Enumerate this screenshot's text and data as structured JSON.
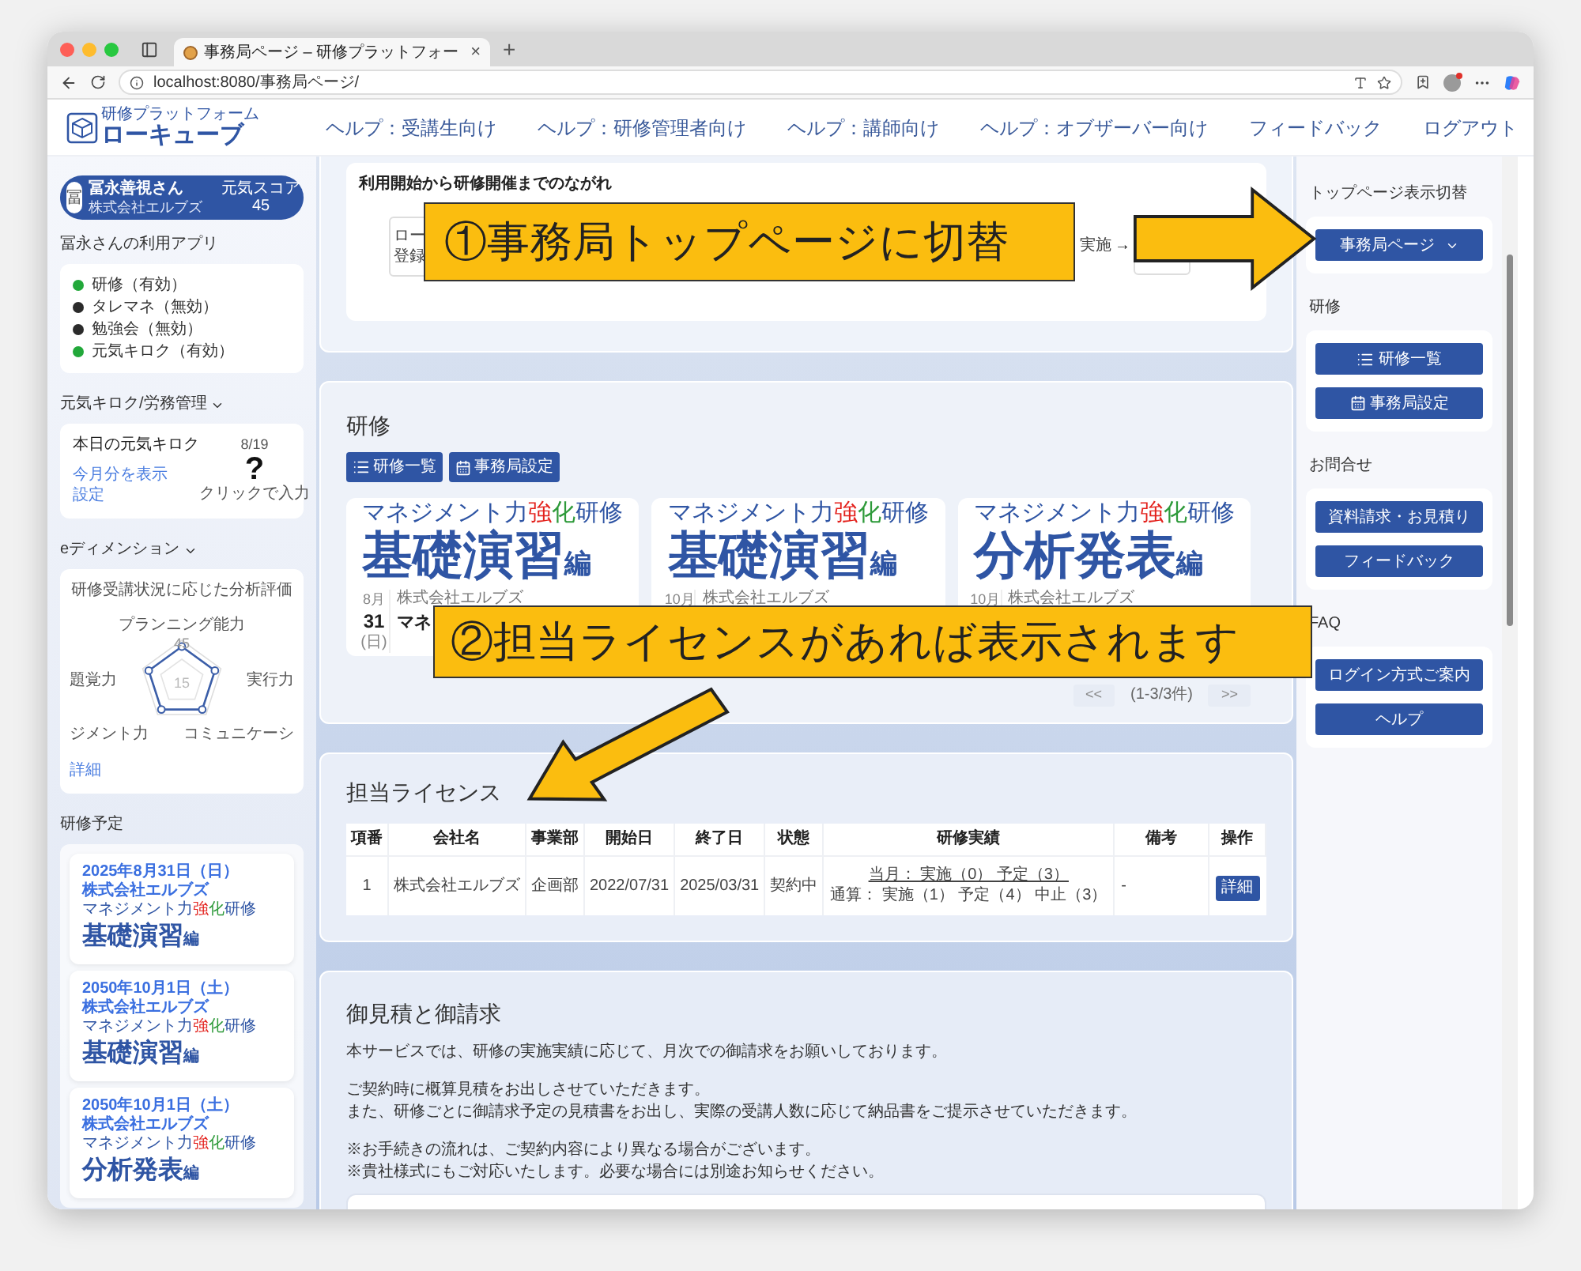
{
  "browser": {
    "tab_title": "事務局ページ – 研修プラットフォー",
    "tab_close": "×",
    "new_tab": "+",
    "url": "localhost:8080/事務局ページ/"
  },
  "header": {
    "logo_small": "研修プラットフォーム",
    "logo_main": "ローキューブ",
    "nav": [
      "ヘルプ：受講生向け",
      "ヘルプ：研修管理者向け",
      "ヘルプ：講師向け",
      "ヘルプ：オブザーバー向け",
      "フィードバック",
      "ログアウト"
    ]
  },
  "user": {
    "avatar": "冨",
    "name": "冨永善視さん",
    "company": "株式会社エルブズ",
    "score_label": "元気スコア",
    "score": "45"
  },
  "apps": {
    "title": "冨永さんの利用アプリ",
    "items": [
      {
        "label": "研修（有効）",
        "color": "#22a83a"
      },
      {
        "label": "タレマネ（無効）",
        "color": "#2b2b2b"
      },
      {
        "label": "勉強会（無効）",
        "color": "#2b2b2b"
      },
      {
        "label": "元気キロク（有効）",
        "color": "#22a83a"
      }
    ]
  },
  "genki": {
    "title": "元気キロク/労務管理",
    "card_title": "本日の元気キロク",
    "date": "8/19",
    "mark": "?",
    "links": [
      "今月分を表示",
      "設定"
    ],
    "prompt": "クリックで入力"
  },
  "edim": {
    "title": "eディメンション",
    "card_title": "研修受講状況に応じた分析評価",
    "axes": [
      "プランニング能力",
      "実行力",
      "コミュニケーシ",
      "ジメント力",
      "題覚力"
    ],
    "ticks": [
      "45",
      "15"
    ],
    "link": "詳細"
  },
  "schedule": {
    "title": "研修予定",
    "items": [
      {
        "date": "2025年8月31日（日）",
        "company": "株式会社エルブズ",
        "logo": {
          "subtitle": [
            {
              "text": "マネジメント力",
              "color": "#2f55a4"
            },
            {
              "text": "強",
              "color": "#e3211c"
            },
            {
              "text": "化",
              "color": "#2e9a3a"
            },
            {
              "text": "研修",
              "color": "#2f55a4"
            }
          ],
          "main": "基礎演習",
          "edition": "編"
        }
      },
      {
        "date": "2050年10月1日（土）",
        "company": "株式会社エルブズ",
        "logo": {
          "subtitle": [
            {
              "text": "マネジメント力",
              "color": "#2f55a4"
            },
            {
              "text": "強",
              "color": "#e3211c"
            },
            {
              "text": "化",
              "color": "#2e9a3a"
            },
            {
              "text": "研修",
              "color": "#2f55a4"
            }
          ],
          "main": "基礎演習",
          "edition": "編"
        }
      },
      {
        "date": "2050年10月1日（土）",
        "company": "株式会社エルブズ",
        "logo": {
          "subtitle": [
            {
              "text": "マネジメント力",
              "color": "#2f55a4"
            },
            {
              "text": "強",
              "color": "#e3211c"
            },
            {
              "text": "化",
              "color": "#2e9a3a"
            },
            {
              "text": "研修",
              "color": "#2f55a4"
            }
          ],
          "main": "分析発表",
          "edition": "編"
        }
      }
    ]
  },
  "flow": {
    "title": "利用開始から研修開催までのながれ",
    "first_step": [
      "ロー",
      "登録"
    ],
    "later_step": "実施",
    "arrow": "→"
  },
  "training": {
    "title": "研修",
    "buttons": [
      {
        "label": "研修一覧"
      },
      {
        "label": "事務局設定"
      }
    ],
    "cards": [
      {
        "logo": {
          "subtitle": [
            {
              "text": "マネジメント力",
              "color": "#2f55a4"
            },
            {
              "text": "強",
              "color": "#e3211c"
            },
            {
              "text": "化",
              "color": "#2e9a3a"
            },
            {
              "text": "研修",
              "color": "#2f55a4"
            }
          ],
          "main": "基礎演習",
          "edition": "編"
        },
        "month": "8月",
        "day": "31",
        "weekday": "(日)",
        "company": "株式会社エルブズ",
        "name": "マネ"
      },
      {
        "logo": {
          "subtitle": [
            {
              "text": "マネジメント力",
              "color": "#2f55a4"
            },
            {
              "text": "強",
              "color": "#e3211c"
            },
            {
              "text": "化",
              "color": "#2e9a3a"
            },
            {
              "text": "研修",
              "color": "#2f55a4"
            }
          ],
          "main": "基礎演習",
          "edition": "編"
        },
        "month": "10月",
        "company": "株式会社エルブズ"
      },
      {
        "logo": {
          "subtitle": [
            {
              "text": "マネジメント力",
              "color": "#2f55a4"
            },
            {
              "text": "強",
              "color": "#e3211c"
            },
            {
              "text": "化",
              "color": "#2e9a3a"
            },
            {
              "text": "研修",
              "color": "#2f55a4"
            }
          ],
          "main": "分析発表",
          "edition": "編"
        },
        "month": "10月",
        "company": "株式会社エルブズ"
      }
    ],
    "pager": {
      "prev": "<<",
      "info": "(1-3/3件)",
      "next": ">>"
    }
  },
  "license": {
    "title": "担当ライセンス",
    "columns": [
      "項番",
      "会社名",
      "事業部",
      "開始日",
      "終了日",
      "状態",
      "研修実績",
      "備考",
      "操作"
    ],
    "rows": [
      {
        "no": "1",
        "company": "株式会社エルブズ",
        "dept": "企画部",
        "start": "2022/07/31",
        "end": "2025/03/31",
        "status": "契約中",
        "month": "当月： 実施（0） 予定（3）",
        "total": "通算： 実施（1） 予定（4） 中止（3）",
        "note": "-",
        "action": "詳細"
      }
    ]
  },
  "estimate": {
    "title": "御見積と御請求",
    "paragraphs": [
      [
        "本サービスでは、研修の実施実績に応じて、月次での御請求をお願いしております。"
      ],
      [
        "ご契約時に概算見積をお出しさせていただきます。",
        "また、研修ごとに御請求予定の見積書をお出し、実際の受講人数に応じて納品書をご提示させていただきます。"
      ],
      [
        "※お手続きの流れは、ご契約内容により異なる場合がございます。",
        "※貴社様式にもご対応いたします。必要な場合には別途お知らせください。"
      ]
    ]
  },
  "right": {
    "sections": [
      {
        "title": "トップページ表示切替",
        "kind": "select",
        "value": "事務局ページ"
      },
      {
        "title": "研修",
        "kind": "icon-buttons",
        "buttons": [
          {
            "label": "研修一覧"
          },
          {
            "label": "事務局設定"
          }
        ]
      },
      {
        "title": "お問合せ",
        "kind": "buttons",
        "buttons": [
          {
            "label": "資料請求・お見積り"
          },
          {
            "label": "フィードバック"
          }
        ]
      },
      {
        "title": "FAQ",
        "kind": "buttons",
        "buttons": [
          {
            "label": "ログイン方式ご案内"
          },
          {
            "label": "ヘルプ"
          }
        ]
      }
    ]
  },
  "annotations": [
    {
      "text": "①事務局トップページに切替",
      "kind": "right"
    },
    {
      "text": "②担当ライセンスがあれば表示されます",
      "kind": "down-left"
    }
  ]
}
